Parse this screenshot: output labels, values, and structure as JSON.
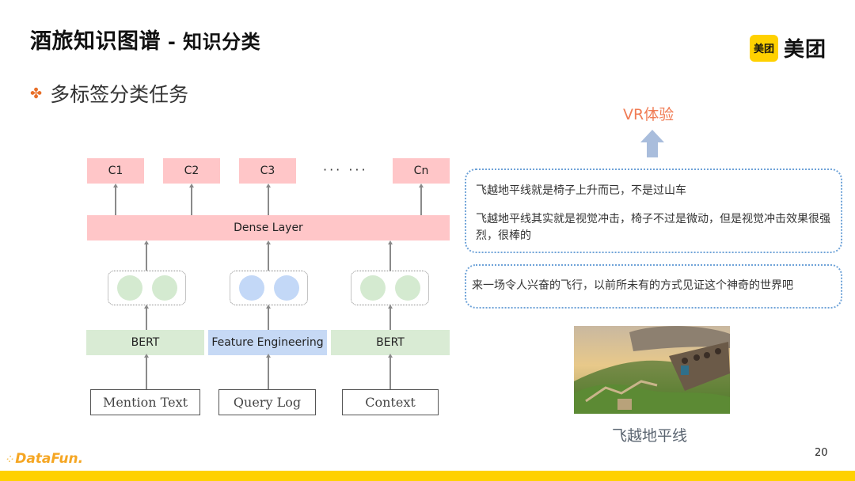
{
  "header": {
    "title_main": "酒旅知识图谱",
    "title_sep": " - ",
    "title_sub": "知识分类",
    "bullet_mark": "✤",
    "bullet_text": "多标签分类任务"
  },
  "logo": {
    "badge_text": "美团",
    "word": "美团",
    "brand_color": "#ffd100"
  },
  "diagram": {
    "classes": [
      "C1",
      "C2",
      "C3",
      "Cn"
    ],
    "ellipsis": "··· ···",
    "dense_layer": "Dense Layer",
    "encoders": [
      {
        "label": "BERT",
        "color": "#d9ebd4"
      },
      {
        "label": "Feature Engineering",
        "color": "#c6d9f5"
      },
      {
        "label": "BERT",
        "color": "#d9ebd4"
      }
    ],
    "inputs": [
      "Mention Text",
      "Query Log",
      "Context"
    ]
  },
  "example": {
    "target_label": "VR体验",
    "reviews": [
      "飞越地平线就是椅子上升而已，不是过山车",
      "飞越地平线其实就是视觉冲击，椅子不过是微动，但是视觉冲击效果很强烈，很棒的"
    ],
    "description": "来一场令人兴奋的飞行，以前所未有的方式见证这个神奇的世界吧",
    "photo_caption": "飞越地平线"
  },
  "footer": {
    "brand": "DataFun.",
    "page_number": "20"
  }
}
